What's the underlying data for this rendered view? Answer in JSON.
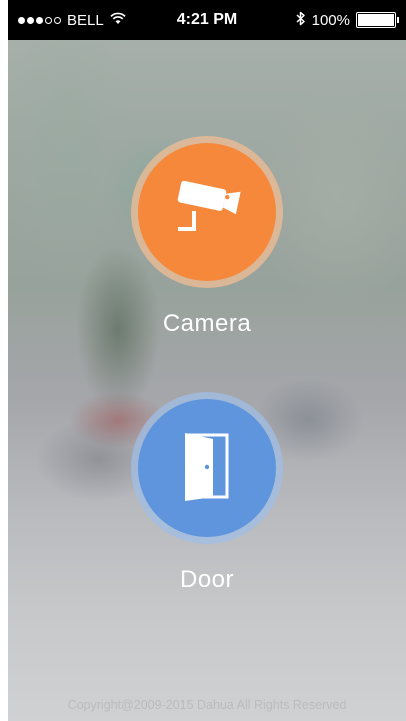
{
  "status_bar": {
    "carrier": "BELL",
    "time": "4:21 PM",
    "battery": "100%",
    "signal_bars_filled": 3,
    "signal_bars_total": 5,
    "icons": [
      "signal-dots",
      "wifi-icon",
      "bluetooth-icon",
      "battery-icon"
    ]
  },
  "tiles": {
    "camera": {
      "label": "Camera",
      "color": "#f6883c",
      "icon": "security-camera-icon"
    },
    "door": {
      "label": "Door",
      "color": "#5e95dc",
      "icon": "door-icon"
    }
  },
  "footer": {
    "copyright": "Copyright@2009-2015 Dahua All Rights Reserved"
  }
}
